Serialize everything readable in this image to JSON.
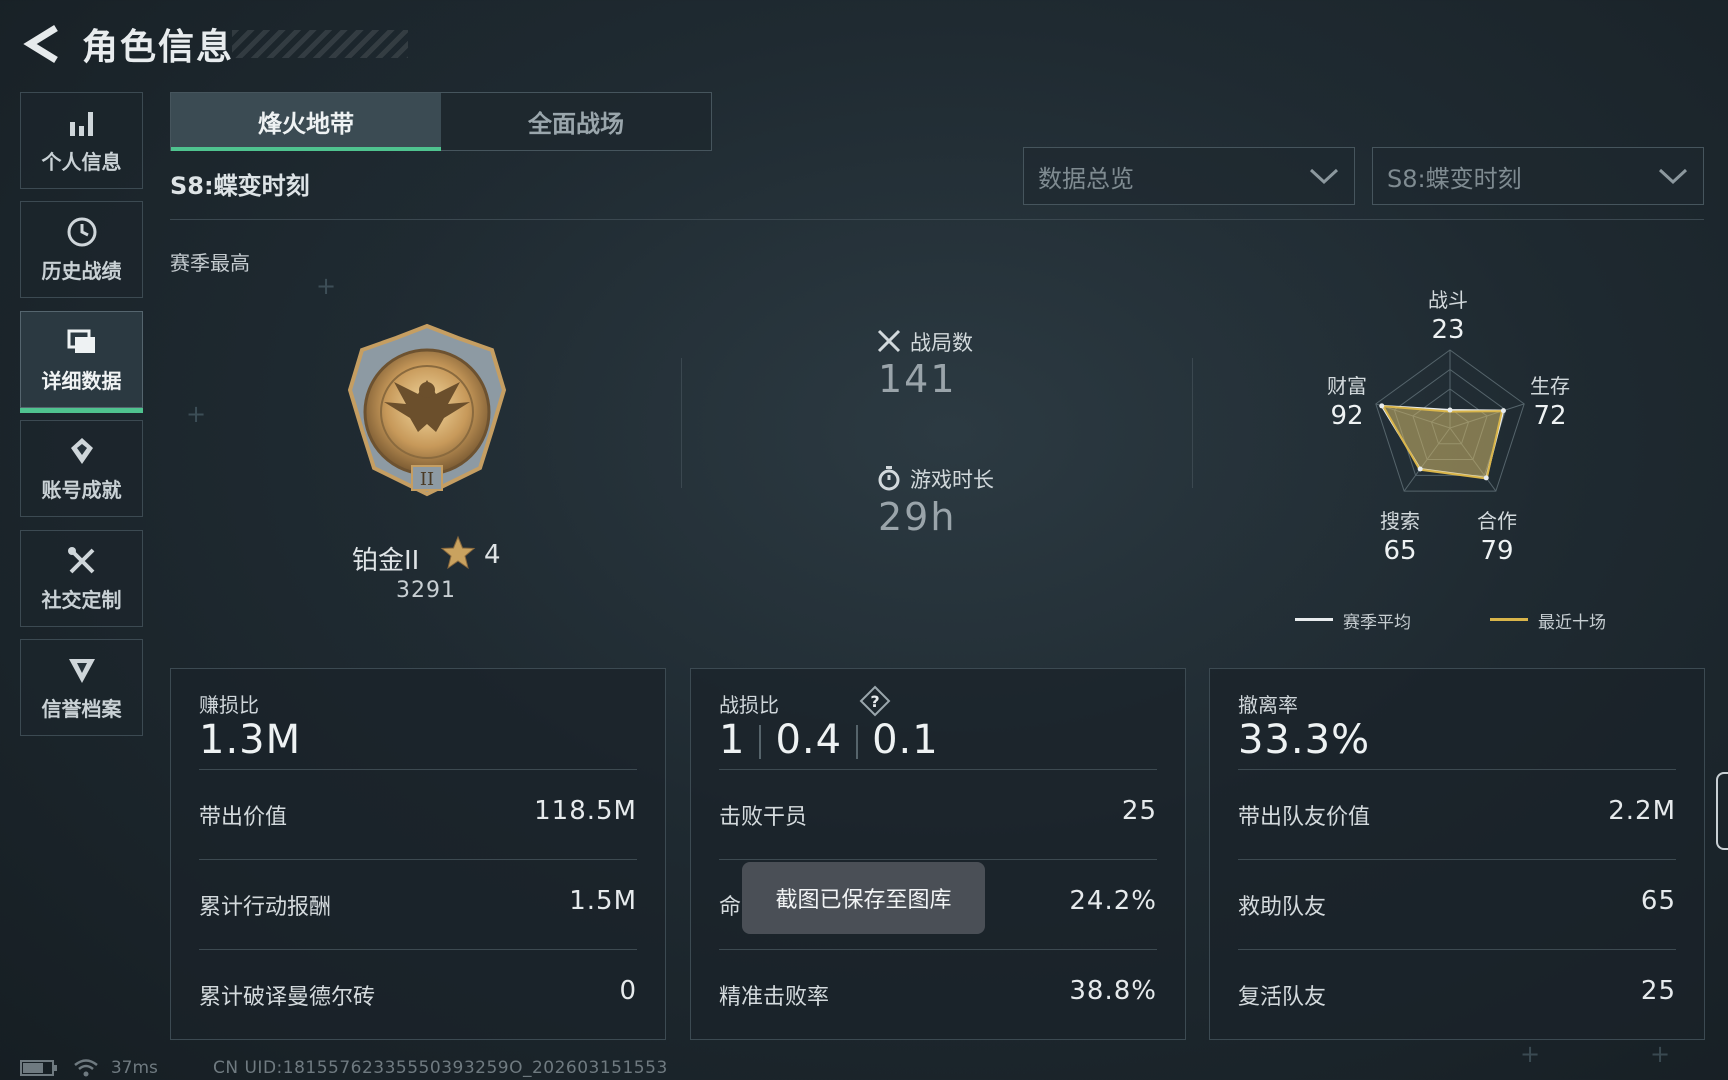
{
  "header": {
    "title": "角色信息"
  },
  "sidebar": {
    "items": [
      {
        "label": "个人信息",
        "icon": "bar-chart-icon",
        "active": false
      },
      {
        "label": "历史战绩",
        "icon": "history-clock-icon",
        "active": false
      },
      {
        "label": "详细数据",
        "icon": "cards-icon",
        "active": true
      },
      {
        "label": "账号成就",
        "icon": "achievement-icon",
        "active": false
      },
      {
        "label": "社交定制",
        "icon": "tools-icon",
        "active": false
      },
      {
        "label": "信誉档案",
        "icon": "shield-v-icon",
        "active": false
      }
    ]
  },
  "tabs": [
    {
      "label": "烽火地带",
      "active": true
    },
    {
      "label": "全面战场",
      "active": false
    }
  ],
  "season": {
    "label": "S8:蝶变时刻",
    "best_label": "赛季最高"
  },
  "filters": {
    "category": "数据总览",
    "season": "S8:蝶变时刻"
  },
  "rank": {
    "name": "铂金II",
    "stars": "4",
    "score": "3291"
  },
  "summary": {
    "matches_label": "战局数",
    "matches_value": "141",
    "playtime_label": "游戏时长",
    "playtime_value": "29h"
  },
  "radar": {
    "axes": [
      {
        "label": "战斗",
        "value": "23"
      },
      {
        "label": "生存",
        "value": "72"
      },
      {
        "label": "合作",
        "value": "79"
      },
      {
        "label": "搜索",
        "value": "65"
      },
      {
        "label": "财富",
        "value": "92"
      }
    ],
    "season_avg": [
      23,
      72,
      79,
      65,
      92
    ],
    "recent_ten": [
      21,
      70,
      80,
      66,
      90
    ],
    "legend": {
      "season_avg": "赛季平均",
      "recent_ten": "最近十场"
    },
    "colors": {
      "season_avg": "#e8ecee",
      "recent_ten": "#d9b54a"
    }
  },
  "cards": {
    "profit": {
      "title": "赚损比",
      "big": "1.3M",
      "rows": [
        {
          "label": "带出价值",
          "value": "118.5M"
        },
        {
          "label": "累计行动报酬",
          "value": "1.5M"
        },
        {
          "label": "累计破译曼德尔砖",
          "value": "0"
        }
      ]
    },
    "combat": {
      "title": "战损比",
      "ratio": [
        "1",
        "0.4",
        "0.1"
      ],
      "rows": [
        {
          "label": "击败干员",
          "value": "25"
        },
        {
          "label": "命",
          "value": "24.2%"
        },
        {
          "label": "精准击败率",
          "value": "38.8%"
        }
      ]
    },
    "extract": {
      "title": "撤离率",
      "big": "33.3%",
      "rows": [
        {
          "label": "带出队友价值",
          "value": "2.2M"
        },
        {
          "label": "救助队友",
          "value": "65"
        },
        {
          "label": "复活队友",
          "value": "25"
        }
      ]
    }
  },
  "toast": "截图已保存至图库",
  "status": {
    "ping": "37ms",
    "uid": "CN UID:18155762335550393259O_202603151553"
  }
}
